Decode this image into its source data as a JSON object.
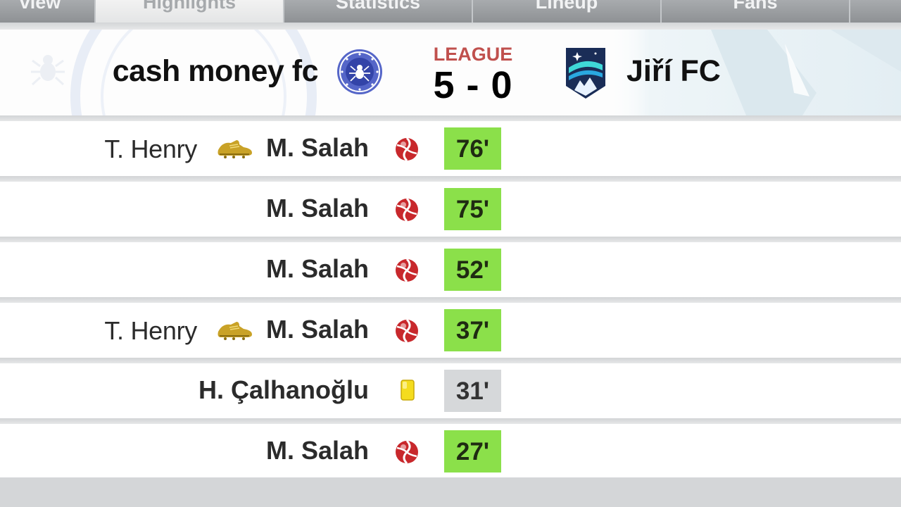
{
  "tabs": [
    {
      "label": "view",
      "active": false
    },
    {
      "label": "Highlights",
      "active": true
    },
    {
      "label": "Statistics",
      "active": false
    },
    {
      "label": "Lineup",
      "active": false
    },
    {
      "label": "Fans",
      "active": false
    }
  ],
  "match": {
    "home": {
      "name": "cash money fc",
      "crest_icon": "spider-crest-icon"
    },
    "away": {
      "name": "Jiří FC",
      "crest_icon": "aurora-shield-crest-icon"
    },
    "competition": "LEAGUE",
    "score": "5 - 0"
  },
  "events": [
    {
      "assist": "T. Henry",
      "player": "M. Salah",
      "type": "goal",
      "minute": "76'"
    },
    {
      "assist": "",
      "player": "M. Salah",
      "type": "goal",
      "minute": "75'"
    },
    {
      "assist": "",
      "player": "M. Salah",
      "type": "goal",
      "minute": "52'"
    },
    {
      "assist": "T. Henry",
      "player": "M. Salah",
      "type": "goal",
      "minute": "37'"
    },
    {
      "assist": "",
      "player": "H. Çalhanoğlu",
      "type": "yellow-card",
      "minute": "31'"
    },
    {
      "assist": "",
      "player": "M. Salah",
      "type": "goal",
      "minute": "27'"
    }
  ],
  "colors": {
    "goal_minute_bg": "#8be04a",
    "card_minute_bg": "#d6d8da",
    "competition": "#c0504d",
    "yellow_card": "#f4dc1e"
  }
}
